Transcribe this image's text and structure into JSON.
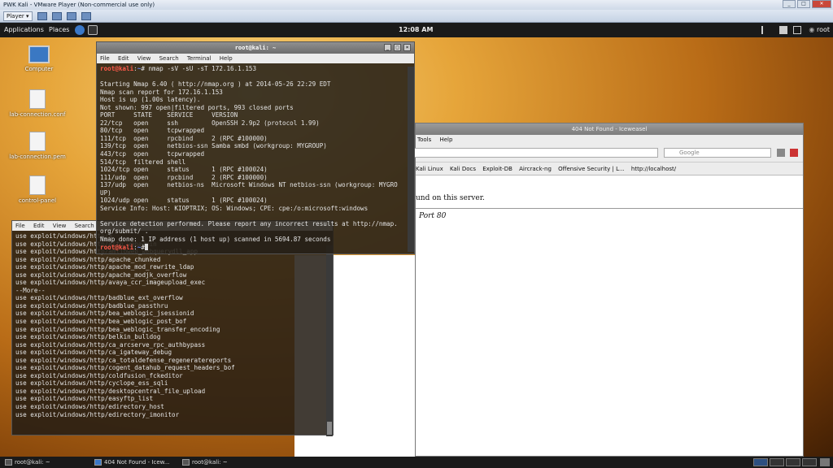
{
  "vmware": {
    "title": "PWK Kali - VMware Player (Non-commercial use only)",
    "player_label": "Player ▾"
  },
  "panel": {
    "applications": "Applications",
    "places": "Places",
    "clock": "12:08 AM",
    "user": "root"
  },
  "desktop": {
    "icons": [
      "Computer",
      "lab-connection.conf",
      "lab-connection.pem",
      "control-panel"
    ]
  },
  "terminal1": {
    "title": "root@kali: ~",
    "menu": [
      "File",
      "Edit",
      "View",
      "Search",
      "Terminal",
      "Help"
    ],
    "prompt_user": "root@kali",
    "prompt_path": "~",
    "command": "# nmap -sV -sU -sT 172.16.1.153",
    "output": [
      "",
      "Starting Nmap 6.40 ( http://nmap.org ) at 2014-05-26 22:29 EDT",
      "Nmap scan report for 172.16.1.153",
      "Host is up (1.00s latency).",
      "Not shown: 997 open|filtered ports, 993 closed ports",
      "PORT     STATE    SERVICE     VERSION",
      "22/tcp   open     ssh         OpenSSH 2.9p2 (protocol 1.99)",
      "80/tcp   open     tcpwrapped",
      "111/tcp  open     rpcbind     2 (RPC #100000)",
      "139/tcp  open     netbios-ssn Samba smbd (workgroup: MYGROUP)",
      "443/tcp  open     tcpwrapped",
      "514/tcp  filtered shell",
      "1024/tcp open     status      1 (RPC #100024)",
      "111/udp  open     rpcbind     2 (RPC #100000)",
      "137/udp  open     netbios-ns  Microsoft Windows NT netbios-ssn (workgroup: MYGRO",
      "UP)",
      "1024/udp open     status      1 (RPC #100024)",
      "Service Info: Host: KIOPTRIX; OS: Windows; CPE: cpe:/o:microsoft:windows",
      "",
      "Service detection performed. Please report any incorrect results at http://nmap.",
      "org/submit/ .",
      "Nmap done: 1 IP address (1 host up) scanned in 5694.87 seconds"
    ],
    "end_prompt": "#"
  },
  "terminal2": {
    "menu": [
      "File",
      "Edit",
      "View",
      "Search"
    ],
    "lines": [
      "use exploit/windows/http/a",
      "use exploit/windows/http/altn_webadmin",
      "use exploit/windows/http/amlibweb_webquerydll_app",
      "use exploit/windows/http/apache_chunked",
      "use exploit/windows/http/apache_mod_rewrite_ldap",
      "use exploit/windows/http/apache_modjk_overflow",
      "use exploit/windows/http/avaya_ccr_imageupload_exec",
      "--More--",
      "use exploit/windows/http/badblue_ext_overflow",
      "use exploit/windows/http/badblue_passthru",
      "use exploit/windows/http/bea_weblogic_jsessionid",
      "use exploit/windows/http/bea_weblogic_post_bof",
      "use exploit/windows/http/bea_weblogic_transfer_encoding",
      "use exploit/windows/http/belkin_bulldog",
      "use exploit/windows/http/ca_arcserve_rpc_authbypass",
      "use exploit/windows/http/ca_igateway_debug",
      "use exploit/windows/http/ca_totaldefense_regeneratereports",
      "use exploit/windows/http/cogent_datahub_request_headers_bof",
      "use exploit/windows/http/coldfusion_fckeditor",
      "use exploit/windows/http/cyclope_ess_sqli",
      "use exploit/windows/http/desktopcentral_file_upload",
      "use exploit/windows/http/easyftp_list",
      "use exploit/windows/http/edirectory_host",
      "use exploit/windows/http/edirectory_imonitor"
    ]
  },
  "browser": {
    "title": "404 Not Found - Iceweasel",
    "menu": [
      "Tools",
      "Help"
    ],
    "search_placeholder": "Google",
    "bookmarks": [
      "Kali Linux",
      "Kali Docs",
      "Exploit-DB",
      "Aircrack-ng",
      "Offensive Security | L...",
      "http://localhost/"
    ],
    "body_text": "und on this server.",
    "address_text": "Port 80"
  },
  "taskbar": {
    "items": [
      "root@kali: ~",
      "404 Not Found - Icew...",
      "root@kali: ~"
    ]
  }
}
